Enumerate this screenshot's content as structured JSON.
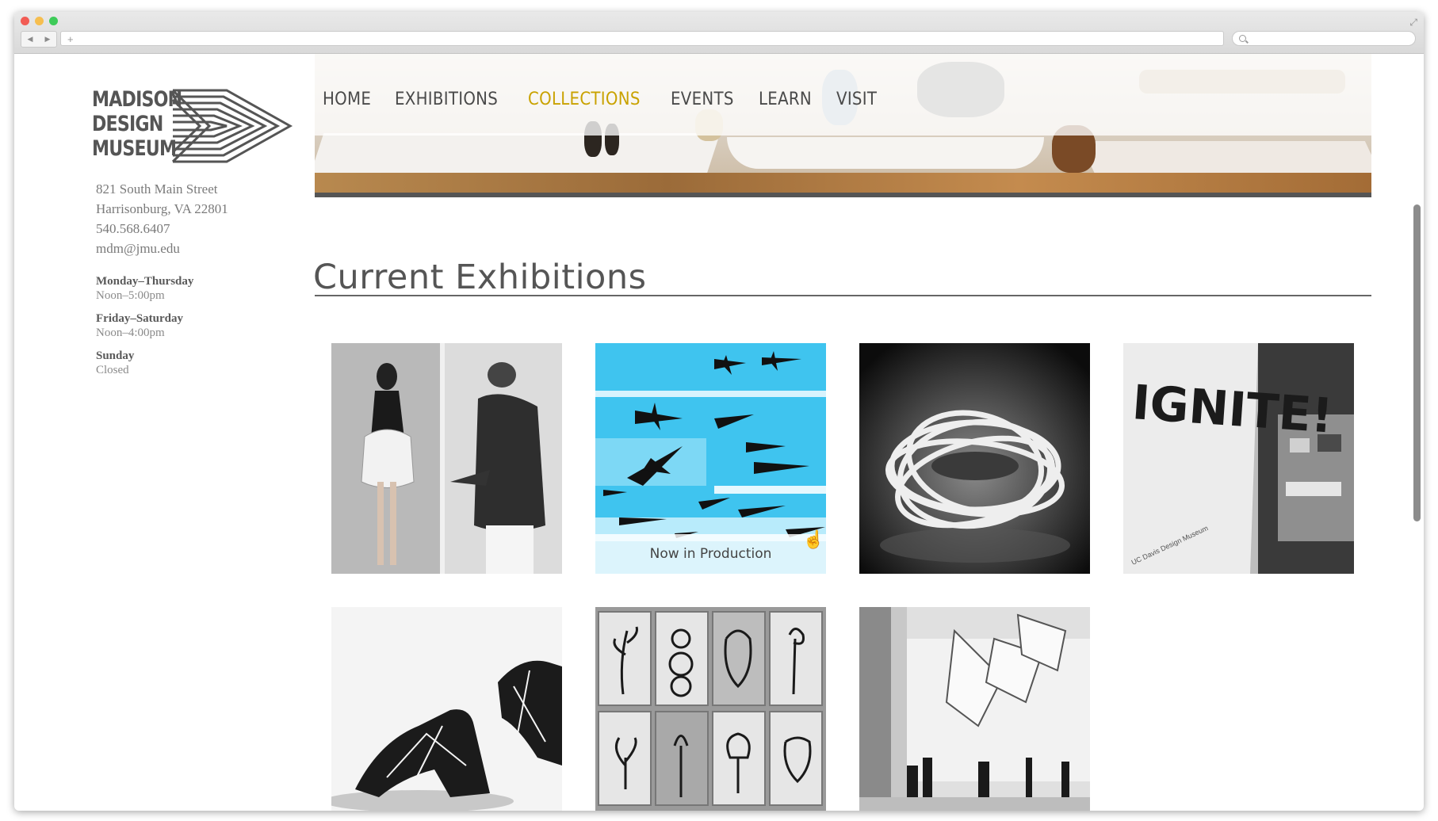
{
  "browser": {
    "new_tab_symbol": "+",
    "back_symbol": "◀",
    "forward_symbol": "▶",
    "expand_symbol": "⤢"
  },
  "logo": {
    "lines": [
      "MADISON",
      "DESIGN",
      "MUSEUM"
    ]
  },
  "nav": {
    "items": [
      "HOME",
      "EXHIBITIONS",
      "COLLECTIONS",
      "EVENTS",
      "LEARN",
      "VISIT"
    ],
    "active": "COLLECTIONS",
    "active_color": "#c9a200"
  },
  "sidebar": {
    "address_line1": "821 South Main Street",
    "address_line2": "Harrisonburg, VA 22801",
    "phone": "540.568.6407",
    "email": "mdm@jmu.edu",
    "hours": [
      {
        "day": "Monday–Thursday",
        "time": "Noon–5:00pm"
      },
      {
        "day": "Friday–Saturday",
        "time": "Noon–4:00pm"
      },
      {
        "day": "Sunday",
        "time": "Closed"
      }
    ]
  },
  "main": {
    "title": "Current Exhibitions",
    "tiles": [
      {
        "image": "fashion-photos-image",
        "caption": ""
      },
      {
        "image": "airplanes-collage-image",
        "caption": "Now in Production"
      },
      {
        "image": "ribbon-chair-image",
        "caption": ""
      },
      {
        "image": "ignite-exhibit-image",
        "caption": "",
        "poster_text": "IGNITE!",
        "poster_subtext": "UC Davis Design Museum"
      },
      {
        "image": "3d-printed-shoes-image",
        "caption": ""
      },
      {
        "image": "vegetable-drawings-image",
        "caption": ""
      },
      {
        "image": "gallery-installation-image",
        "caption": ""
      }
    ]
  }
}
